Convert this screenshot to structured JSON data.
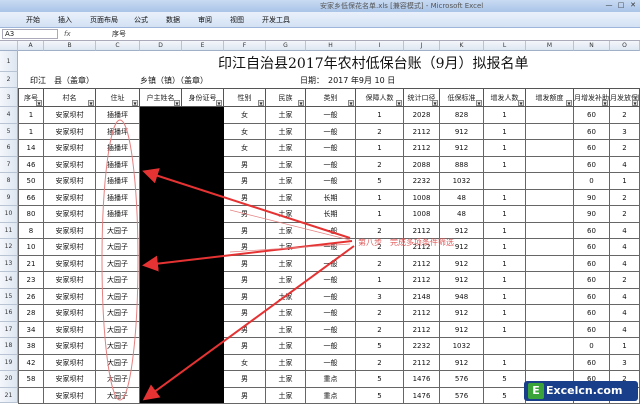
{
  "window": {
    "title": "安家乡低保花名单.xls [兼容模式] - Microsoft Excel",
    "controls": [
      "—",
      "□",
      "✕"
    ]
  },
  "ribbon": {
    "tabs": [
      "开始",
      "插入",
      "页面布局",
      "公式",
      "数据",
      "审阅",
      "视图",
      "开发工具"
    ]
  },
  "formula_bar": {
    "name_box": "A3",
    "fx": "fx",
    "value": "序号"
  },
  "columns": [
    "A",
    "B",
    "C",
    "D",
    "E",
    "F",
    "G",
    "H",
    "I",
    "J",
    "K",
    "L",
    "M",
    "N",
    "O"
  ],
  "rows": [
    "1",
    "2",
    "3",
    "4",
    "5",
    "6",
    "7",
    "8",
    "9",
    "10",
    "11",
    "12",
    "13",
    "14",
    "15",
    "16",
    "17",
    "18",
    "19",
    "20",
    "21",
    "22",
    "23",
    "24"
  ],
  "sheet": {
    "title": "印江自治县2017年农村低保台账（9月）拟报名单",
    "county": "印江　县（盖章）",
    "town": "乡镇（镇）（盖章）",
    "date": "日期：　2017 年9月 10 日",
    "headers": [
      "序号",
      "村名",
      "住址",
      "户主姓名",
      "身份证号",
      "性别",
      "民族",
      "类别",
      "保障人数",
      "统计口径",
      "低保标准",
      "增发人数",
      "增发额度",
      "月增发补助金",
      "月发放保障金"
    ],
    "body": [
      [
        "1",
        "安家坝村",
        "插播坪",
        "",
        "",
        "女",
        "土家",
        "一般",
        "1",
        "2028",
        "828",
        "1",
        "",
        "60",
        "2"
      ],
      [
        "1",
        "安家坝村",
        "插播坪",
        "",
        "",
        "女",
        "土家",
        "一般",
        "2",
        "2112",
        "912",
        "1",
        "",
        "60",
        "3"
      ],
      [
        "14",
        "安家坝村",
        "插播坪",
        "",
        "",
        "女",
        "土家",
        "一般",
        "1",
        "2112",
        "912",
        "1",
        "",
        "60",
        "2"
      ],
      [
        "46",
        "安家坝村",
        "插播坪",
        "",
        "",
        "男",
        "土家",
        "一般",
        "2",
        "2088",
        "888",
        "1",
        "",
        "60",
        "4"
      ],
      [
        "50",
        "安家坝村",
        "插播坪",
        "",
        "",
        "男",
        "土家",
        "一般",
        "5",
        "2232",
        "1032",
        "",
        "",
        "0",
        "1"
      ],
      [
        "66",
        "安家坝村",
        "插播坪",
        "",
        "",
        "男",
        "土家",
        "长期",
        "1",
        "1008",
        "48",
        "1",
        "",
        "90",
        "2"
      ],
      [
        "80",
        "安家坝村",
        "插播坪",
        "",
        "",
        "男",
        "土家",
        "长期",
        "1",
        "1008",
        "48",
        "1",
        "",
        "90",
        "2"
      ],
      [
        "8",
        "安家坝村",
        "大园子",
        "",
        "",
        "男",
        "土家",
        "一般",
        "2",
        "2112",
        "912",
        "1",
        "",
        "60",
        "4"
      ],
      [
        "10",
        "安家坝村",
        "大园子",
        "",
        "",
        "男",
        "土家",
        "一般",
        "2",
        "2112",
        "912",
        "1",
        "",
        "60",
        "4"
      ],
      [
        "21",
        "安家坝村",
        "大园子",
        "",
        "",
        "男",
        "土家",
        "一般",
        "2",
        "2112",
        "912",
        "1",
        "",
        "60",
        "4"
      ],
      [
        "23",
        "安家坝村",
        "大园子",
        "",
        "",
        "男",
        "土家",
        "一般",
        "1",
        "2112",
        "912",
        "1",
        "",
        "60",
        "2"
      ],
      [
        "26",
        "安家坝村",
        "大园子",
        "",
        "",
        "男",
        "土家",
        "一般",
        "3",
        "2148",
        "948",
        "1",
        "",
        "60",
        "4"
      ],
      [
        "28",
        "安家坝村",
        "大园子",
        "",
        "",
        "男",
        "土家",
        "一般",
        "2",
        "2112",
        "912",
        "1",
        "",
        "60",
        "4"
      ],
      [
        "34",
        "安家坝村",
        "大园子",
        "",
        "",
        "男",
        "土家",
        "一般",
        "2",
        "2112",
        "912",
        "1",
        "",
        "60",
        "4"
      ],
      [
        "38",
        "安家坝村",
        "大园子",
        "",
        "",
        "男",
        "土家",
        "一般",
        "5",
        "2232",
        "1032",
        "",
        "",
        "0",
        "1"
      ],
      [
        "42",
        "安家坝村",
        "大园子",
        "",
        "",
        "女",
        "土家",
        "一般",
        "2",
        "2112",
        "912",
        "1",
        "",
        "60",
        "3"
      ],
      [
        "58",
        "安家坝村",
        "大园子",
        "",
        "",
        "男",
        "土家",
        "重点",
        "5",
        "1476",
        "576",
        "5",
        "",
        "60",
        "2"
      ],
      [
        "",
        "安家坝村",
        "大园子",
        "",
        "",
        "男",
        "土家",
        "重点",
        "5",
        "1476",
        "576",
        "5",
        "",
        "60",
        "2"
      ]
    ]
  },
  "annotation": {
    "text": "第八步　完成多项条件筛选"
  },
  "watermark": {
    "text": "Excelcn.com",
    "logo": "E"
  }
}
